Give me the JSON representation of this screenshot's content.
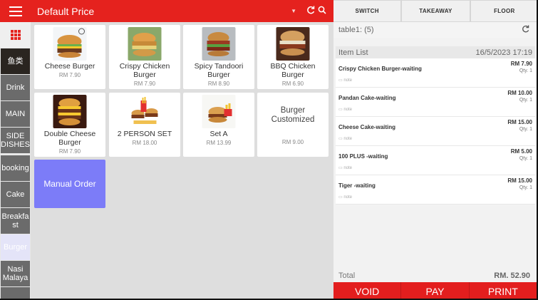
{
  "header": {
    "title": "Default Price",
    "menu_icon": "hamburger-icon",
    "caret": "▼",
    "refresh_icon": "C",
    "search_icon": "search-icon"
  },
  "sidebar": {
    "grid_icon": "apps-grid-icon",
    "categories": [
      "鱼类",
      "Drink",
      "MAIN",
      "SIDE DISHES",
      "booking",
      "Cake",
      "Breakfast",
      "Burger",
      "Nasi Malaya"
    ]
  },
  "products": [
    {
      "name": "Cheese Burger",
      "price": "RM 7.90"
    },
    {
      "name": "Crispy Chicken Burger",
      "price": "RM 7.90"
    },
    {
      "name": "Spicy Tandoori Burger",
      "price": "RM 8.90"
    },
    {
      "name": "BBQ Chicken Burger",
      "price": "RM 6.90"
    },
    {
      "name": "Double Cheese Burger",
      "price": "RM 7.90"
    },
    {
      "name": "2 PERSON SET",
      "price": "RM 18.00"
    },
    {
      "name": "Set A",
      "price": "RM 13.99"
    },
    {
      "name": "Burger Customized",
      "price": "RM 9.00"
    }
  ],
  "manual_order": "Manual Order",
  "right_tabs": [
    "SWITCH",
    "TAKEAWAY",
    "FLOOR"
  ],
  "order": {
    "table": "table1: (5)",
    "list_label": "Item List",
    "datetime": "16/5/2023 17:19",
    "items": [
      {
        "name": "Crispy Chicken Burger-waiting",
        "price": "RM 7.90",
        "qty": "Qty. 1",
        "note": "note"
      },
      {
        "name": "Pandan Cake-waiting",
        "price": "RM 10.00",
        "qty": "Qty. 1",
        "note": "note"
      },
      {
        "name": "Cheese Cake-waiting",
        "price": "RM 15.00",
        "qty": "Qty. 1",
        "note": "note"
      },
      {
        "name": "100 PLUS -waiting",
        "price": "RM 5.00",
        "qty": "Qty. 1",
        "note": "note"
      },
      {
        "name": "Tiger -waiting",
        "price": "RM 15.00",
        "qty": "Qty. 1",
        "note": "note"
      }
    ],
    "total_label": "Total",
    "total": "RM. 52.90"
  },
  "actions": [
    "VOID",
    "PAY",
    "PRINT"
  ],
  "colors": {
    "accent": "#e5221e",
    "manual": "#7c7cf8"
  }
}
